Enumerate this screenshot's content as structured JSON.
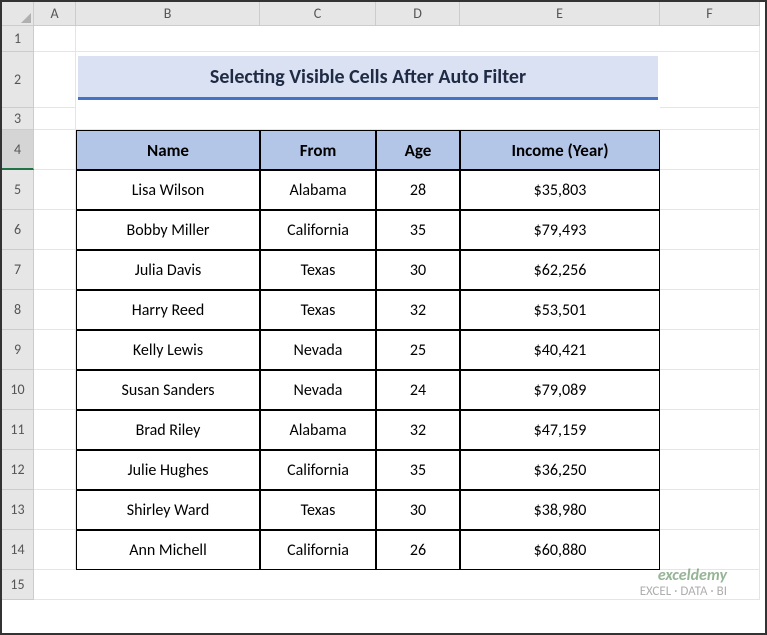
{
  "columns": [
    "A",
    "B",
    "C",
    "D",
    "E",
    "F"
  ],
  "rows": [
    "1",
    "2",
    "3",
    "4",
    "5",
    "6",
    "7",
    "8",
    "9",
    "10",
    "11",
    "12",
    "13",
    "14",
    "15"
  ],
  "title": "Selecting Visible Cells After Auto Filter",
  "selected_row_index": 3,
  "headers": {
    "name": "Name",
    "from": "From",
    "age": "Age",
    "income": "Income (Year)"
  },
  "chart_data": {
    "type": "table",
    "title": "Selecting Visible Cells After Auto Filter",
    "columns": [
      "Name",
      "From",
      "Age",
      "Income (Year)"
    ],
    "rows": [
      {
        "name": "Lisa Wilson",
        "from": "Alabama",
        "age": "28",
        "income": "$35,803"
      },
      {
        "name": "Bobby Miller",
        "from": "California",
        "age": "35",
        "income": "$79,493"
      },
      {
        "name": "Julia Davis",
        "from": "Texas",
        "age": "30",
        "income": "$62,256"
      },
      {
        "name": "Harry Reed",
        "from": "Texas",
        "age": "32",
        "income": "$53,501"
      },
      {
        "name": "Kelly Lewis",
        "from": "Nevada",
        "age": "25",
        "income": "$40,421"
      },
      {
        "name": "Susan Sanders",
        "from": "Nevada",
        "age": "24",
        "income": "$79,089"
      },
      {
        "name": "Brad Riley",
        "from": "Alabama",
        "age": "32",
        "income": "$47,159"
      },
      {
        "name": "Julie Hughes",
        "from": "California",
        "age": "35",
        "income": "$36,250"
      },
      {
        "name": "Shirley Ward",
        "from": "Texas",
        "age": "30",
        "income": "$38,980"
      },
      {
        "name": "Ann Michell",
        "from": "California",
        "age": "26",
        "income": "$60,880"
      }
    ]
  },
  "watermark": {
    "brand": "exceldemy",
    "tag": "EXCEL · DATA · BI"
  }
}
